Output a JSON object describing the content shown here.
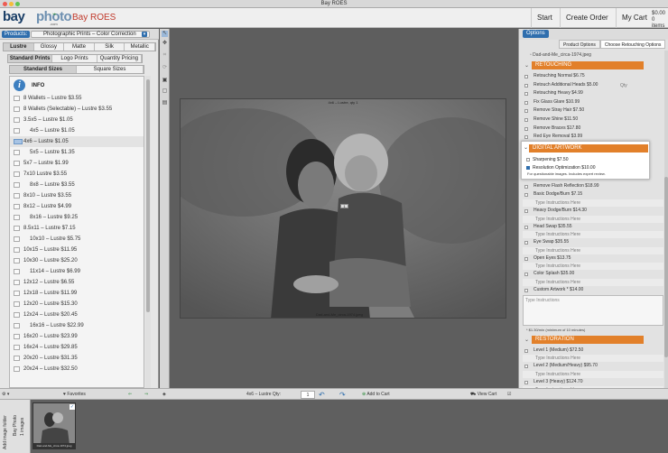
{
  "window": {
    "title": "Bay ROES"
  },
  "toolbar": {
    "logo_primary": "bay",
    "logo_secondary": "photo",
    "logo_sub": ".com",
    "app_name": "Bay ROES",
    "start": "Start",
    "create_order": "Create Order",
    "my_cart": "My Cart",
    "cart_total": "$0.00",
    "cart_items": "0 items"
  },
  "products": {
    "label": "Products:",
    "selected": "Photographic Prints – Color Correction",
    "finish_tabs": [
      "Lustre",
      "Glossy",
      "Matte",
      "Silk",
      "Metallic"
    ],
    "print_tabs": [
      "Standard Prints",
      "Logo Prints",
      "Quantity Pricing"
    ],
    "size_tabs": [
      "Standard Sizes",
      "Square Sizes"
    ],
    "info_label": "INFO",
    "sizes": [
      "8 Wallets – Lustre $3.55",
      "8 Wallets (Selectable) – Lustre $3.55",
      "3.5x5 – Lustre $1.05",
      "4x5 – Lustre $1.05",
      "4x6 – Lustre $1.05",
      "5x5 – Lustre $1.35",
      "5x7 – Lustre $1.99",
      "7x10 Lustre $3.55",
      "8x8 – Lustre $3.55",
      "8x10 – Lustre $3.55",
      "8x12 – Lustre $4.99",
      "8x16 – Lustre $9.25",
      "8.5x11 – Lustre $7.15",
      "10x10 – Lustre $5.75",
      "10x15 – Lustre $11.95",
      "10x30 – Lustre $25.20",
      "11x14 – Lustre $6.99",
      "12x12 – Lustre $6.55",
      "12x18 – Lustre $11.99",
      "12x20 – Lustre $15.30",
      "12x24 – Lustre $20.45",
      "16x16 – Lustre $22.99",
      "16x20 – Lustre $23.99",
      "16x24 – Lustre $29.85",
      "20x20 – Lustre $31.35",
      "20x24 – Lustre $32.50"
    ]
  },
  "canvas": {
    "top_caption": "4x6 – Lustre, qty 1",
    "bottom_caption": "Dad-and-Me_circa-1974.jpeg",
    "qty_badge": "1"
  },
  "options": {
    "button": "Options",
    "tabs": [
      "Product Options",
      "Choose Retouching Options"
    ],
    "filename": "Dad-and-Me_circa-1974.jpeg",
    "retouching_title": "RETOUCHING",
    "retouching": [
      "Retouching Normal $6.75",
      "Retouch Additional Heads $5.00",
      "Retouching Heavy $4.99",
      "Fix Glass Glare $10.99",
      "Remove Stray Hair $7.50",
      "Remove Shine $11.50",
      "Remove Braces $17.80",
      "Red Eye Removal $3.99"
    ],
    "qty_hint": "Qty",
    "digital_title": "DIGITAL ARTWORK",
    "digital": [
      "Sharpening $7.50",
      "Resolution Optimization $10.00"
    ],
    "digital_note": "For questionable images. Includes expert review.",
    "more_items": [
      {
        "label": "Remove Flash Reflection $18.99",
        "note": ""
      },
      {
        "label": "Basic Dodge/Burn $7.15",
        "note": "Type Instructions Here"
      },
      {
        "label": "Heavy Dodge/Burn $14.30",
        "note": "Type Instructions Here"
      },
      {
        "label": "Head Swap $35.55",
        "note": "Type Instructions Here"
      },
      {
        "label": "Eye Swap $35.55",
        "note": "Type Instructions Here"
      },
      {
        "label": "Open Eyes $13.75",
        "note": "Type Instructions Here"
      },
      {
        "label": "Color Splash $35.00",
        "note": "Type Instructions Here"
      },
      {
        "label": "Custom Artwork *  $14.00",
        "note": ""
      }
    ],
    "instr_placeholder": "Type Instructions",
    "instr_foot": "* $1.30/min (minimum of 10 minutes)",
    "restoration_title": "RESTORATION",
    "restoration": [
      {
        "label": "Level 1 (Medium) $72.50",
        "note": "Type Instructions Here"
      },
      {
        "label": "Level 2 (Medium/Heavy) $95.70",
        "note": "Type Instructions Here"
      },
      {
        "label": "Level 3 (Heavy) $124.70",
        "note": "Type Instructions Here"
      }
    ]
  },
  "bottombar": {
    "favorites": "Favorites",
    "product_qty_label": "4x6 – Lustre Qty:",
    "qty_value": "1",
    "add_to_cart": "Add to Cart",
    "view_cart": "View Cart"
  },
  "film": {
    "add_image_label": "Add image folder",
    "bay_photo_label": "Bay Photo",
    "image_count": "1 images",
    "thumb_caption": "Dad-and-Me_circa-1974.jpeg"
  }
}
